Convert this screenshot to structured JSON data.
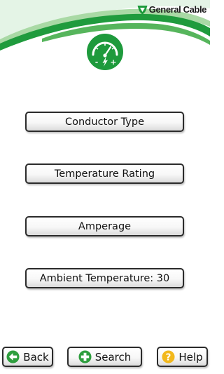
{
  "header": {
    "brand": "General Cable",
    "logo_icon": "general-cable-shield-logo",
    "app_icon": "gauge-icon",
    "gauge_minus": "-",
    "gauge_plus": "+",
    "accent_color": "#1e9a3c"
  },
  "options": [
    {
      "label": "Conductor Type"
    },
    {
      "label": "Temperature Rating"
    },
    {
      "label": "Amperage"
    },
    {
      "label": "Ambient Temperature: 30"
    }
  ],
  "footer": {
    "back": {
      "label": "Back",
      "icon": "arrow-left-icon",
      "color": "#2e9e3e"
    },
    "search": {
      "label": "Search",
      "icon": "plus-icon",
      "color": "#2e9e3e"
    },
    "help": {
      "label": "Help",
      "icon": "question-icon",
      "color": "#f2b81c"
    }
  }
}
